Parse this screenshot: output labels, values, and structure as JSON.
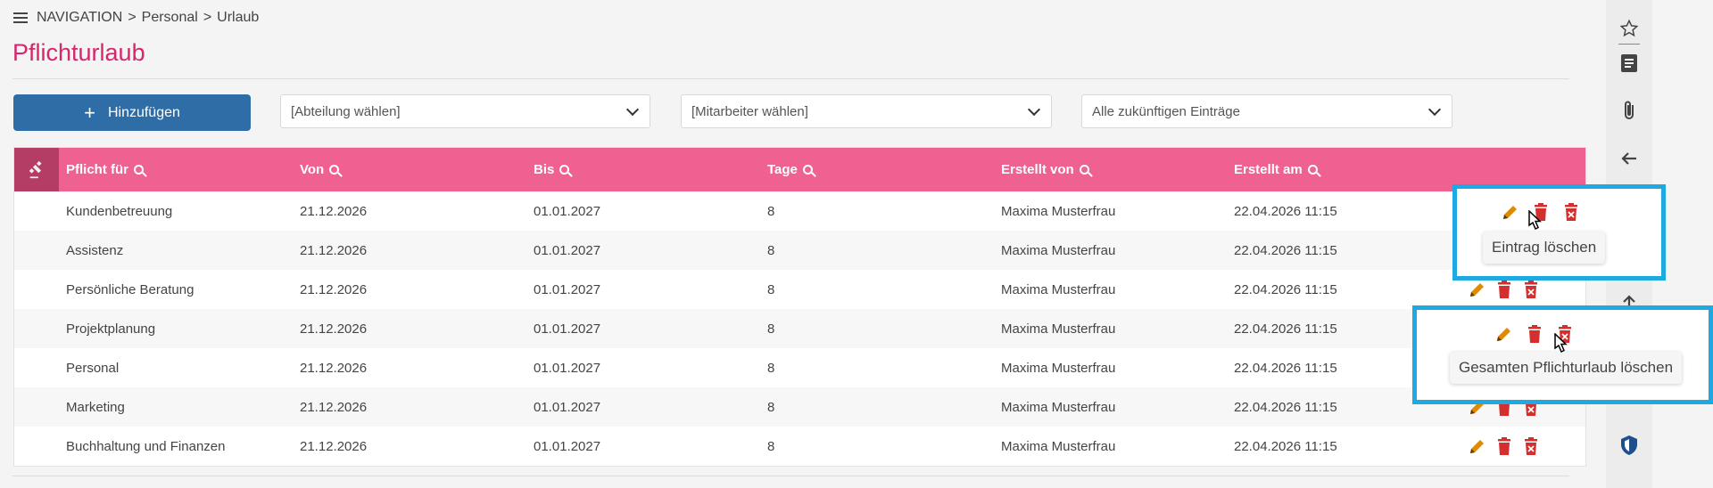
{
  "breadcrumb": {
    "root": "NAVIGATION",
    "sep": ">",
    "level1": "Personal",
    "level2": "Urlaub"
  },
  "page": {
    "title": "Pflichturlaub"
  },
  "toolbar": {
    "add_label": "Hinzufügen",
    "department_select": "[Abteilung wählen]",
    "employee_select": "[Mitarbeiter wählen]",
    "filter_select": "Alle zukünftigen Einträge"
  },
  "table": {
    "headers": {
      "pflicht_fuer": "Pflicht für",
      "von": "Von",
      "bis": "Bis",
      "tage": "Tage",
      "erstellt_von": "Erstellt von",
      "erstellt_am": "Erstellt am"
    },
    "rows": [
      {
        "pflicht_fuer": "Kundenbetreuung",
        "von": "21.12.2026",
        "bis": "01.01.2027",
        "tage": "8",
        "erstellt_von": "Maxima Musterfrau",
        "erstellt_am": "22.04.2026 11:15"
      },
      {
        "pflicht_fuer": "Assistenz",
        "von": "21.12.2026",
        "bis": "01.01.2027",
        "tage": "8",
        "erstellt_von": "Maxima Musterfrau",
        "erstellt_am": "22.04.2026 11:15"
      },
      {
        "pflicht_fuer": "Persönliche Beratung",
        "von": "21.12.2026",
        "bis": "01.01.2027",
        "tage": "8",
        "erstellt_von": "Maxima Musterfrau",
        "erstellt_am": "22.04.2026 11:15"
      },
      {
        "pflicht_fuer": "Projektplanung",
        "von": "21.12.2026",
        "bis": "01.01.2027",
        "tage": "8",
        "erstellt_von": "Maxima Musterfrau",
        "erstellt_am": "22.04.2026 11:15"
      },
      {
        "pflicht_fuer": "Personal",
        "von": "21.12.2026",
        "bis": "01.01.2027",
        "tage": "8",
        "erstellt_von": "Maxima Musterfrau",
        "erstellt_am": "22.04.2026 11:15"
      },
      {
        "pflicht_fuer": "Marketing",
        "von": "21.12.2026",
        "bis": "01.01.2027",
        "tage": "8",
        "erstellt_von": "Maxima Musterfrau",
        "erstellt_am": "22.04.2026 11:15"
      },
      {
        "pflicht_fuer": "Buchhaltung und Finanzen",
        "von": "21.12.2026",
        "bis": "01.01.2027",
        "tage": "8",
        "erstellt_von": "Maxima Musterfrau",
        "erstellt_am": "22.04.2026 11:15"
      }
    ]
  },
  "tooltips": {
    "delete_entry": "Eintrag löschen",
    "delete_all": "Gesamten Pflichturlaub löschen"
  },
  "colors": {
    "accent": "#d6266c",
    "header_bg": "#ef6191",
    "header_icon_bg": "#b33d64",
    "button_bg": "#2f6da6",
    "edit_icon": "#e08a00",
    "delete_icon": "#d32f2f",
    "highlight": "#1ea9e0"
  },
  "icons": {
    "menu": "hamburger-icon",
    "header": "gavel-icon",
    "edit": "pencil-icon",
    "delete": "trash-icon",
    "delete_all": "trash-x-icon",
    "sidebar": [
      "star-icon",
      "note-icon",
      "paperclip-icon",
      "arrow-left-icon",
      "arrow-up-icon",
      "shield-icon"
    ]
  }
}
